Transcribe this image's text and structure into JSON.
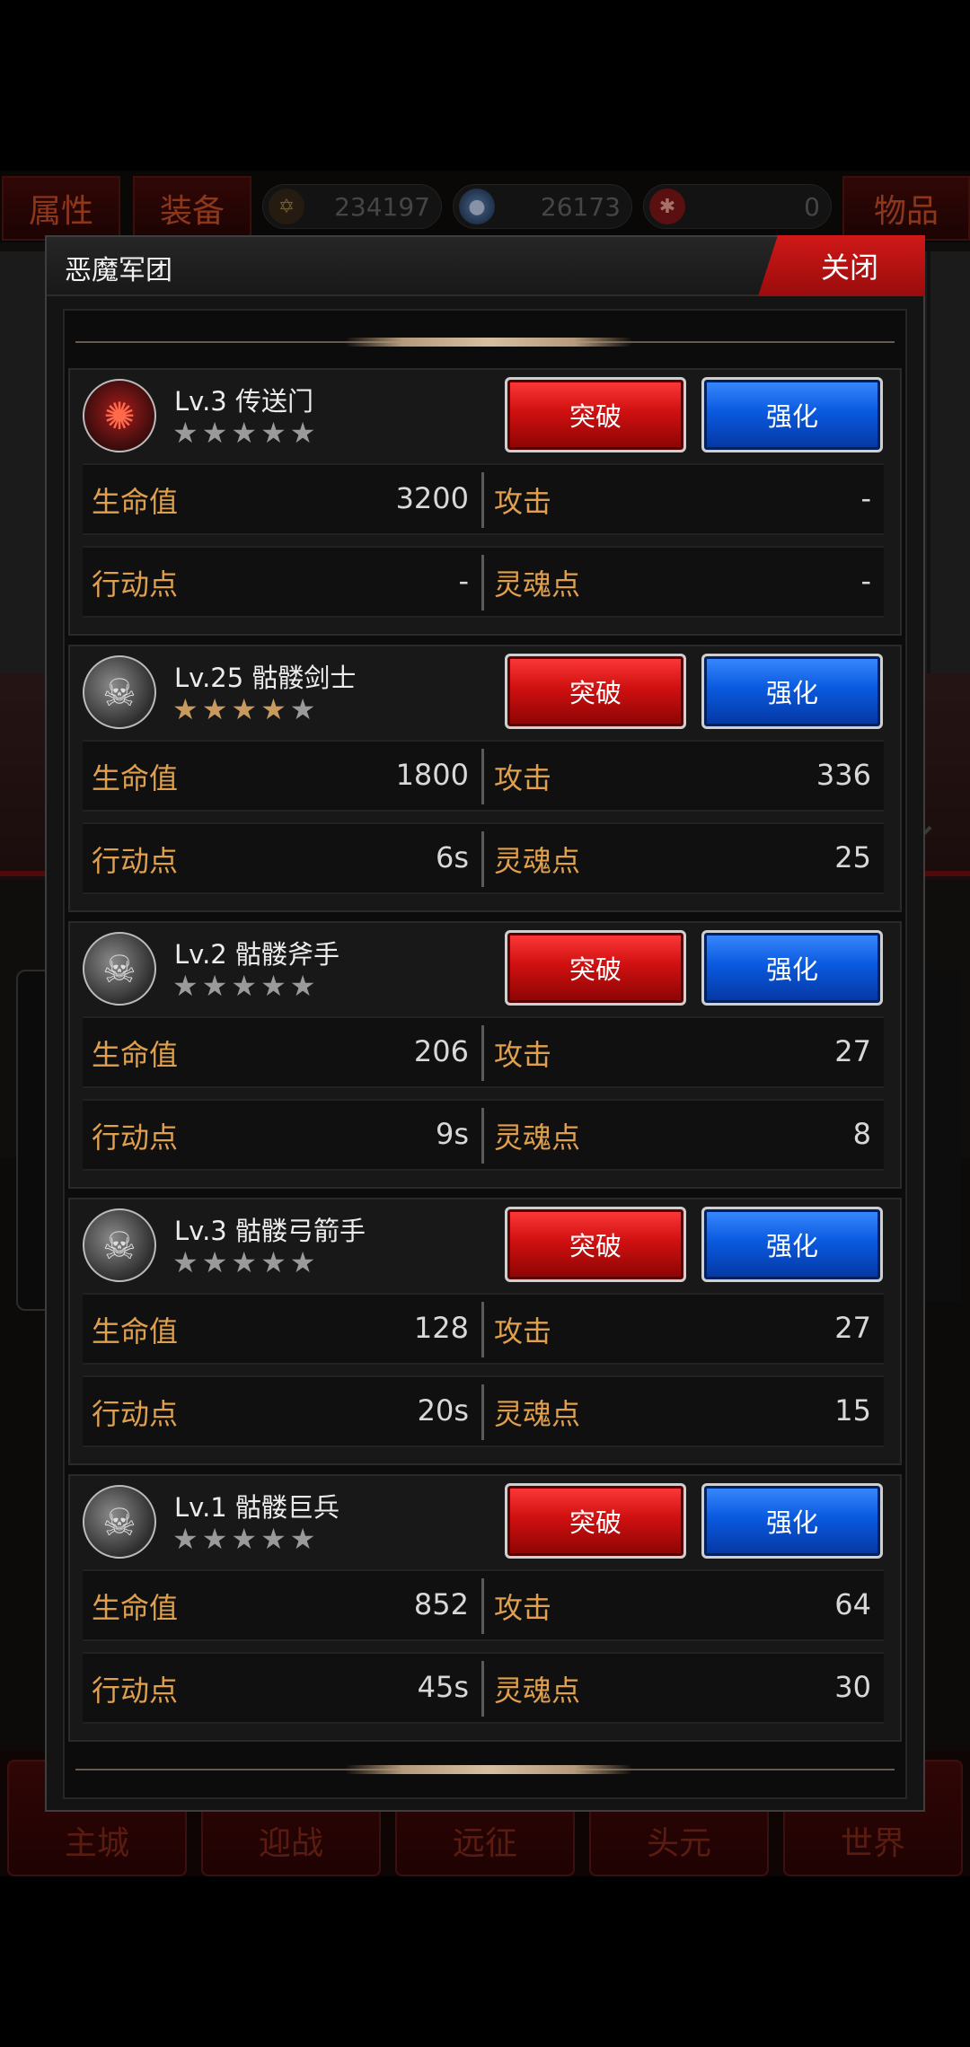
{
  "top_tabs": {
    "attributes": "属性",
    "equipment": "装备",
    "items": "物品"
  },
  "resources": [
    {
      "icon": "star-of-david-icon",
      "value": "234197"
    },
    {
      "icon": "blue-orb-icon",
      "value": "26173"
    },
    {
      "icon": "red-emblem-icon",
      "value": "0"
    }
  ],
  "bottom_nav": [
    "主城",
    "迎战",
    "远征",
    "头元",
    "世界"
  ],
  "dialog": {
    "title": "恶魔军团",
    "close_label": "关闭",
    "break_label": "突破",
    "upgrade_label": "强化",
    "stat_labels": {
      "hp": "生命值",
      "attack": "攻击",
      "action": "行动点",
      "soul": "灵魂点"
    },
    "units": [
      {
        "name": "Lv.3 传送门",
        "stars_lit": 0,
        "portrait": "demon-portal-icon",
        "hp": "3200",
        "attack": "-",
        "action": "-",
        "soul": "-"
      },
      {
        "name": "Lv.25 骷髅剑士",
        "stars_lit": 4,
        "portrait": "skeleton-swordsman-icon",
        "hp": "1800",
        "attack": "336",
        "action": "6s",
        "soul": "25"
      },
      {
        "name": "Lv.2 骷髅斧手",
        "stars_lit": 0,
        "portrait": "skeleton-axeman-icon",
        "hp": "206",
        "attack": "27",
        "action": "9s",
        "soul": "8"
      },
      {
        "name": "Lv.3 骷髅弓箭手",
        "stars_lit": 0,
        "portrait": "skeleton-archer-icon",
        "hp": "128",
        "attack": "27",
        "action": "20s",
        "soul": "15"
      },
      {
        "name": "Lv.1 骷髅巨兵",
        "stars_lit": 0,
        "portrait": "skeleton-giant-icon",
        "hp": "852",
        "attack": "64",
        "action": "45s",
        "soul": "30"
      }
    ]
  }
}
